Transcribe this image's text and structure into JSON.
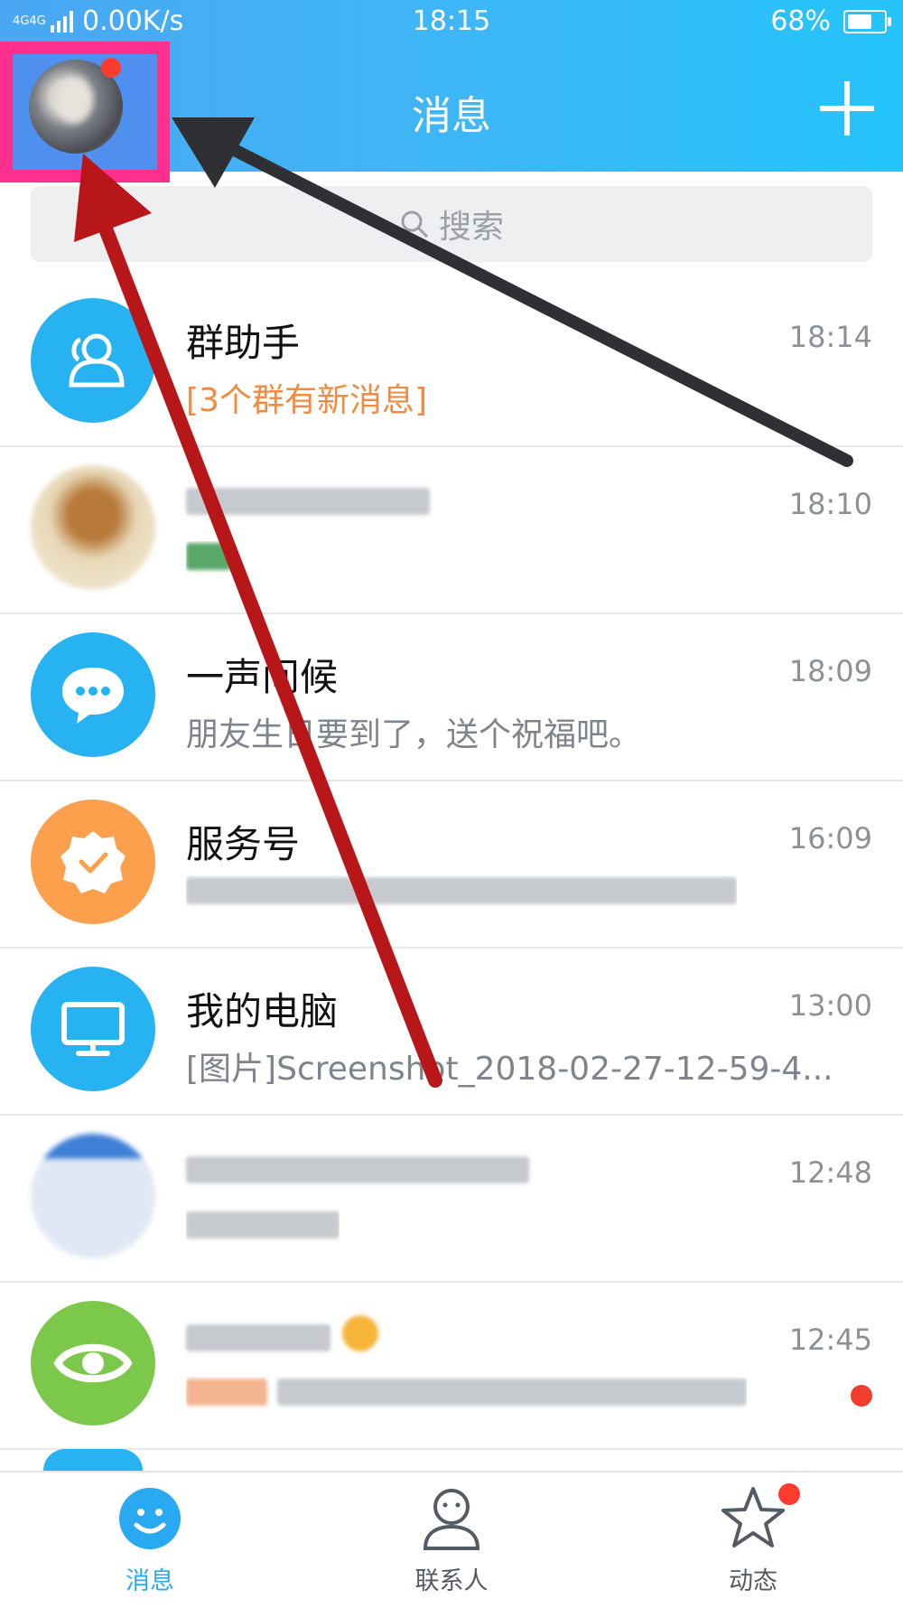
{
  "status_bar": {
    "network": "4G",
    "network2": "4G",
    "speed": "0.00K/s",
    "time": "18:15",
    "battery": "68%",
    "battery_level": 0.68
  },
  "header": {
    "title": "消息"
  },
  "search": {
    "placeholder": "搜索"
  },
  "conversations": [
    {
      "name": "群助手",
      "message": "[3个群有新消息]",
      "time": "18:14",
      "icon": "group-icon",
      "color": "#27b3f1"
    },
    {
      "name": "",
      "message": "",
      "time": "18:10",
      "icon": "blurred-avatar",
      "color": "#d9c7a8"
    },
    {
      "name": "一声问候",
      "message": "朋友生日要到了，送个祝福吧。",
      "time": "18:09",
      "icon": "chat-bubble-icon",
      "color": "#27b3f1"
    },
    {
      "name": "服务号",
      "message": "",
      "time": "16:09",
      "icon": "badge-check-icon",
      "color": "#fca04d"
    },
    {
      "name": "我的电脑",
      "message": "[图片]Screenshot_2018-02-27-12-59-4...",
      "time": "13:00",
      "icon": "monitor-icon",
      "color": "#27b3f1"
    },
    {
      "name": "",
      "message": "",
      "time": "12:48",
      "icon": "blurred-avatar",
      "color": "#cfd9e6"
    },
    {
      "name": "",
      "message": "",
      "time": "12:45",
      "icon": "eye-icon",
      "color": "#7cc84a"
    }
  ],
  "tabs": [
    {
      "label": "消息",
      "icon": "smile-icon",
      "active": true
    },
    {
      "label": "联系人",
      "icon": "person-icon",
      "active": false
    },
    {
      "label": "动态",
      "icon": "star-icon",
      "active": false
    }
  ],
  "colors": {
    "accent": "#27b3f1",
    "highlight_box": "#ff2f8e",
    "arrow_red": "#b8171a",
    "arrow_dark": "#2e3033"
  }
}
